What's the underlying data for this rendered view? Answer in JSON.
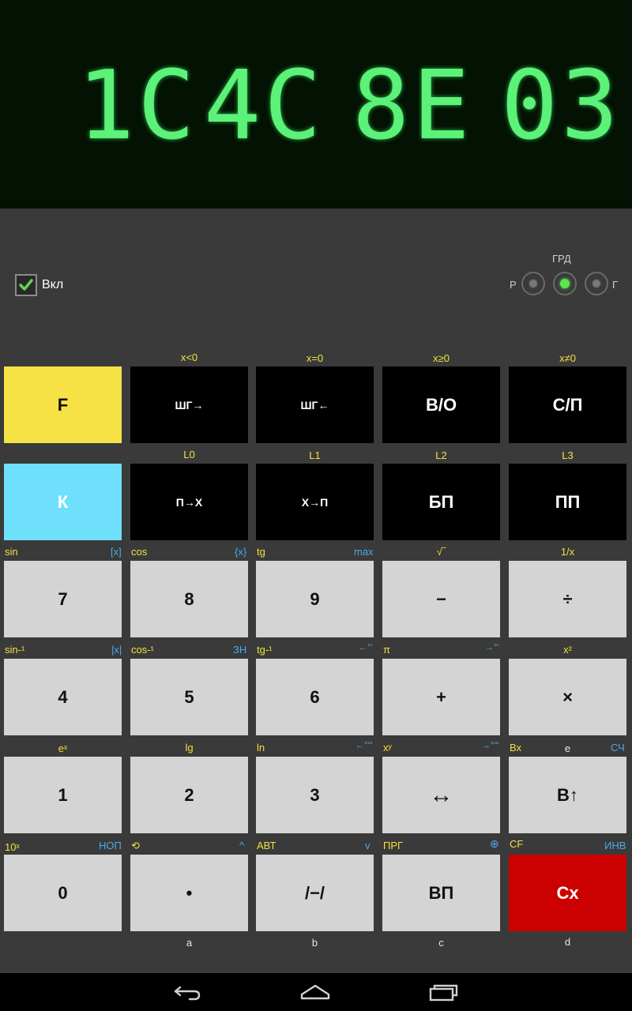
{
  "display": {
    "digits": [
      "1C",
      "4C",
      "8E",
      "03"
    ],
    "color": "#5cf27a"
  },
  "power": {
    "label": "Вкл",
    "checked": true
  },
  "angle_mode": {
    "title": "ГРД",
    "left_label": "Р",
    "right_label": "Г",
    "options": [
      "radian",
      "grad",
      "degree"
    ],
    "selected": 1
  },
  "rows": [
    {
      "keys": [
        "F",
        "ШГ→",
        "ШГ←",
        "В/О",
        "С/П"
      ],
      "above": [
        {
          "left": "",
          "right": "",
          "center": ""
        },
        {
          "left": "",
          "right": "",
          "center": "x<0"
        },
        {
          "left": "",
          "right": "",
          "center": "x=0"
        },
        {
          "left": "",
          "right": "",
          "center": "x≥0"
        },
        {
          "left": "",
          "right": "",
          "center": "x≠0"
        }
      ]
    },
    {
      "keys": [
        "К",
        "П→X",
        "X→П",
        "БП",
        "ПП"
      ],
      "above": [
        {
          "left": "",
          "right": "",
          "center": ""
        },
        {
          "left": "",
          "right": "",
          "center": "L0"
        },
        {
          "left": "",
          "right": "",
          "center": "L1"
        },
        {
          "left": "",
          "right": "",
          "center": "L2"
        },
        {
          "left": "",
          "right": "",
          "center": "L3"
        }
      ]
    },
    {
      "keys": [
        "7",
        "8",
        "9",
        "−",
        "÷"
      ],
      "above": [
        {
          "left": "sin",
          "right": "[x]",
          "center": ""
        },
        {
          "left": "cos",
          "right": "{x}",
          "center": ""
        },
        {
          "left": "tg",
          "right": "max",
          "center": ""
        },
        {
          "left": "",
          "right": "",
          "center": "√‾"
        },
        {
          "left": "",
          "right": "",
          "center": "1/x"
        }
      ]
    },
    {
      "keys": [
        "4",
        "5",
        "6",
        "+",
        "×"
      ],
      "above": [
        {
          "left": "sin-¹",
          "right": "|x|",
          "center": ""
        },
        {
          "left": "cos-¹",
          "right": "ЗН",
          "center": ""
        },
        {
          "left": "tg-¹",
          "right": "←°'",
          "center": ""
        },
        {
          "left": "π",
          "right": "→°'",
          "center": ""
        },
        {
          "left": "",
          "right": "",
          "center": "x²"
        }
      ]
    },
    {
      "keys": [
        "1",
        "2",
        "3",
        "↔",
        "В↑"
      ],
      "above": [
        {
          "left": "",
          "right": "",
          "center": "eˣ"
        },
        {
          "left": "",
          "right": "",
          "center": "lg"
        },
        {
          "left": "ln",
          "right": "←°'\"",
          "center": ""
        },
        {
          "left": "xʸ",
          "right": "→°'\"",
          "center": ""
        },
        {
          "left": "Вх",
          "right": "СЧ",
          "center": "e"
        }
      ]
    },
    {
      "keys": [
        "0",
        "•",
        "/−/",
        "ВП",
        "Сx"
      ],
      "above": [
        {
          "left": "10ˣ",
          "right": "НОП",
          "center": ""
        },
        {
          "left": "⟲",
          "right": "^",
          "center": ""
        },
        {
          "left": "АВТ",
          "right": "v",
          "center": ""
        },
        {
          "left": "ПРГ",
          "right": "⊕",
          "center": ""
        },
        {
          "left": "CF",
          "right": "ИНВ",
          "center": ""
        }
      ]
    }
  ],
  "below": [
    "",
    "a",
    "b",
    "c",
    "d"
  ],
  "nav": {
    "back": "back-icon",
    "home": "home-icon",
    "recents": "recents-icon"
  }
}
